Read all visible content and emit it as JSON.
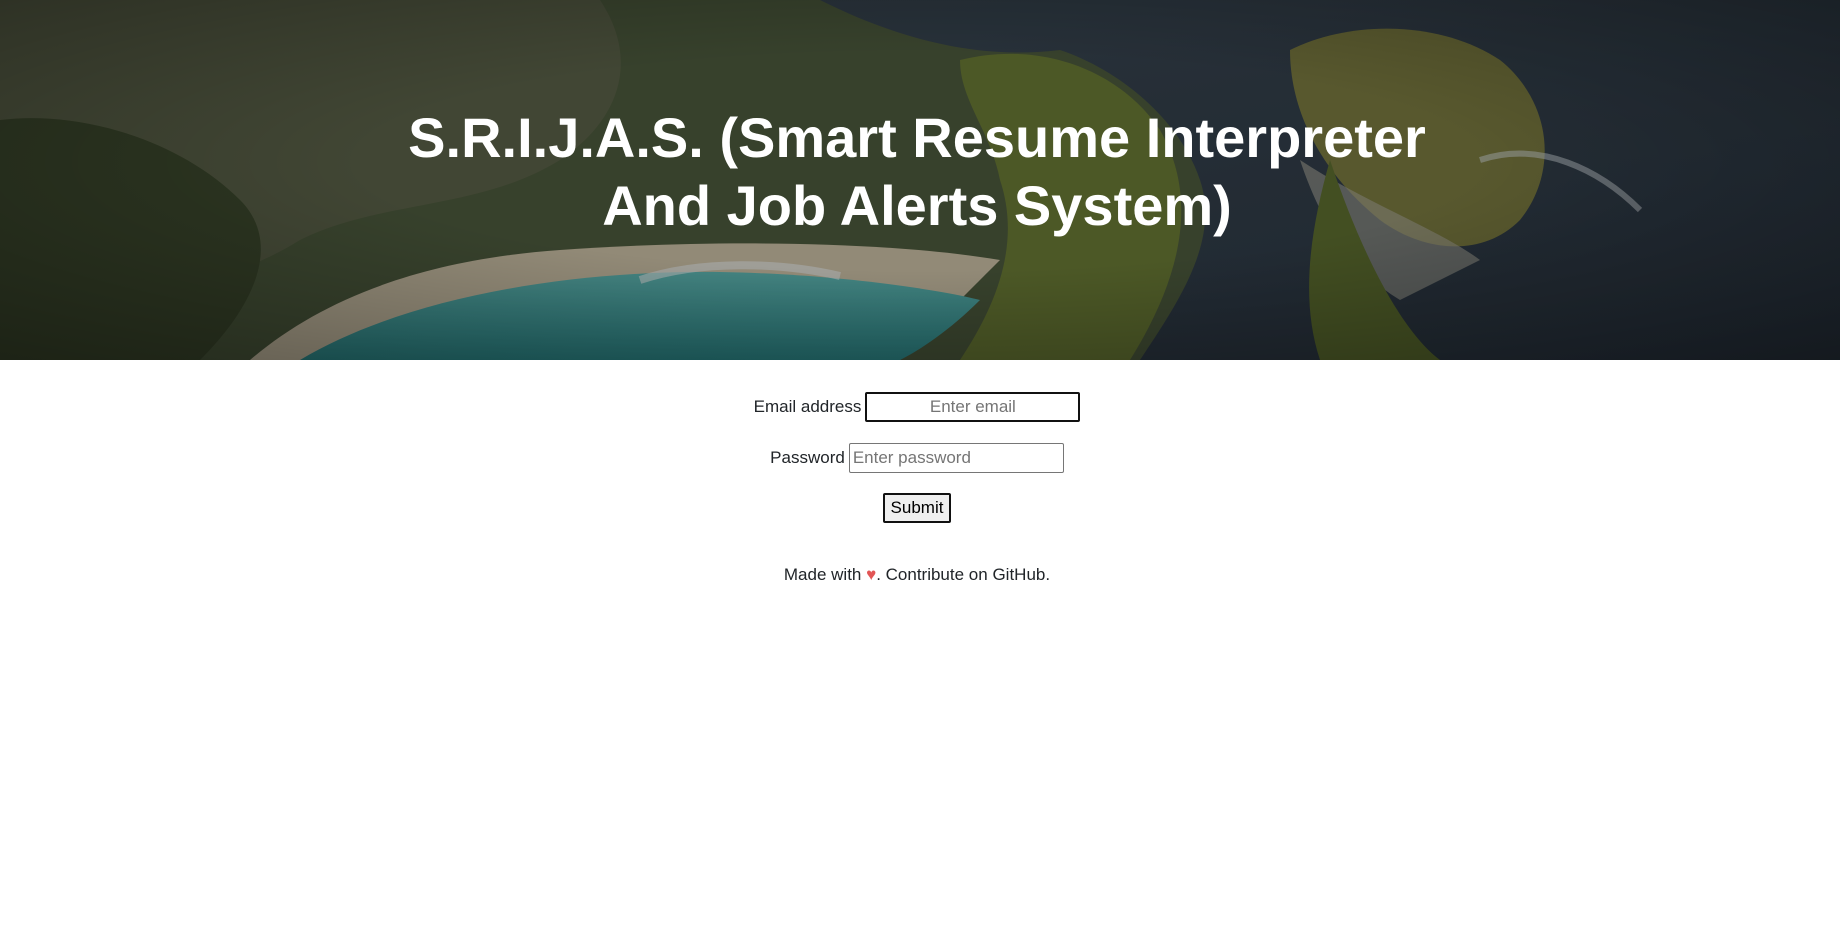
{
  "hero": {
    "title_line1": "S.R.I.J.A.S. (Smart Resume Interpreter",
    "title_line2": "And Job Alerts System)"
  },
  "form": {
    "email_label": "Email address",
    "email_placeholder": "Enter email",
    "password_label": "Password",
    "password_placeholder": "Enter password",
    "submit_label": "Submit"
  },
  "footer": {
    "made_with": "Made with ",
    "heart": "♥",
    "contribute": ". Contribute on ",
    "github": "GitHub",
    "end": "."
  },
  "colors": {
    "heart": "#e25555",
    "text": "#212529"
  },
  "icons": {
    "heart": "heart-icon"
  }
}
